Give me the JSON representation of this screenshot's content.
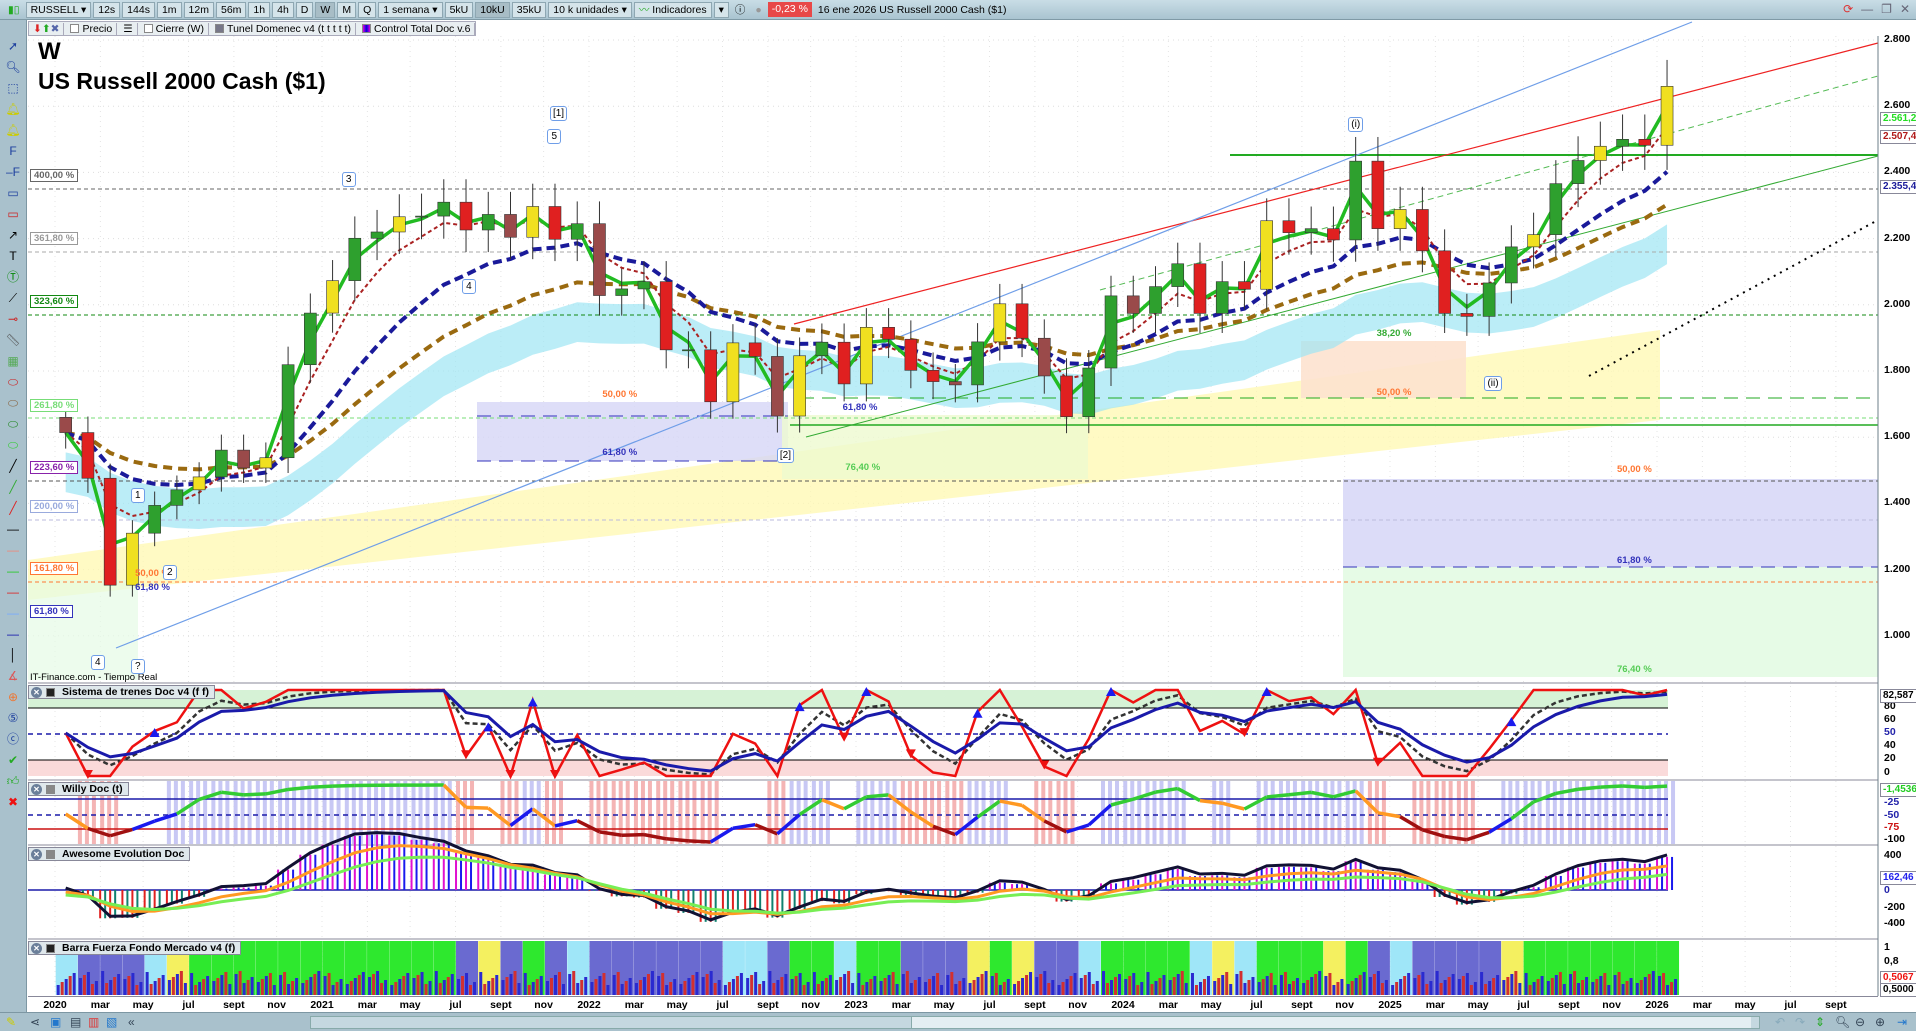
{
  "toolbar": {
    "symbol": "RUSSELL",
    "timeframes": [
      "12s",
      "144s",
      "1m",
      "12m",
      "56m",
      "1h",
      "4h",
      "D",
      "W",
      "M",
      "Q"
    ],
    "selected_timeframe": "W",
    "period": "1 semana",
    "units": [
      "5kU",
      "10kU",
      "35kU"
    ],
    "selected_unit": "10kU",
    "units_select": "10 k unidades",
    "indicators_label": "Indicadores",
    "change": "-0,23 %",
    "date_instrument": "16 ene 2026 US Russell 2000 Cash ($1)"
  },
  "legend": {
    "precio": "Precio",
    "cierre": "Cierre (W)",
    "tunel": "Tunel Domenec v4 (t t t t t)",
    "control": "Control Total Doc v.6"
  },
  "main": {
    "timeframe_letter": "W",
    "instrument_title": "US Russell 2000 Cash ($1)",
    "source": "IT-Finance.com - Tiempo Real",
    "price_ticks": [
      "2.800",
      "2.600",
      "2.400",
      "2.200",
      "2.000",
      "1.800",
      "1.600",
      "1.400",
      "1.200",
      "1.000"
    ],
    "badges": [
      {
        "text": "2.561,2",
        "color": "#22dd22"
      },
      {
        "text": "2.507,4",
        "color": "#b01818"
      },
      {
        "text": "2.355,4",
        "color": "#1a1a9a"
      }
    ],
    "fib_left": [
      {
        "text": "400,00 %",
        "price": 2374,
        "color": "#666666"
      },
      {
        "text": "361,80 %",
        "price": 2184,
        "color": "#999999"
      },
      {
        "text": "323,60 %",
        "price": 1993,
        "color": "#118811"
      },
      {
        "text": "261,80 %",
        "price": 1679,
        "color": "#77dd77"
      },
      {
        "text": "223,60 %",
        "price": 1492,
        "color": "#8822aa"
      },
      {
        "text": "200,00 %",
        "price": 1374,
        "color": "#99aadd"
      },
      {
        "text": "161,80 %",
        "price": 1187,
        "color": "#ff7733"
      },
      {
        "text": "61,80 %",
        "price": 1057,
        "color": "#3333bb"
      }
    ],
    "fib_annotations": [
      {
        "text": "50,00 %",
        "t": 2022.05,
        "price": 1727,
        "color": "#ff7733"
      },
      {
        "text": "61,80 %",
        "t": 2022.95,
        "price": 1688,
        "color": "#3333bb"
      },
      {
        "text": "61,80 %",
        "t": 2022.05,
        "price": 1552,
        "color": "#3333bb"
      },
      {
        "text": "76,40 %",
        "t": 2022.96,
        "price": 1506,
        "color": "#55cc55"
      },
      {
        "text": "38,20 %",
        "t": 2024.95,
        "price": 1912,
        "color": "#33aa33"
      },
      {
        "text": "50,00 %",
        "t": 2024.95,
        "price": 1733,
        "color": "#ff7733"
      },
      {
        "text": "50,00 %",
        "t": 2025.85,
        "price": 1501,
        "color": "#ff7733"
      },
      {
        "text": "61,80 %",
        "t": 2025.85,
        "price": 1226,
        "color": "#3333bb"
      },
      {
        "text": "76,40 %",
        "t": 2025.85,
        "price": 897,
        "color": "#55cc55"
      },
      {
        "text": "50,00 %",
        "t": 2020.3,
        "price": 1188,
        "color": "#ff7733"
      },
      {
        "text": "61,80 %",
        "t": 2020.3,
        "price": 1143,
        "color": "#3333bb"
      }
    ],
    "wave_labels": [
      {
        "text": "3",
        "t": 2021.1,
        "price": 2377
      },
      {
        "text": "4",
        "t": 2021.55,
        "price": 2054
      },
      {
        "text": "1",
        "t": 2020.31,
        "price": 1422
      },
      {
        "text": "2",
        "t": 2020.43,
        "price": 1190
      },
      {
        "text": "4",
        "t": 2020.16,
        "price": 918
      },
      {
        "text": "?",
        "t": 2020.31,
        "price": 906
      },
      {
        "text": "[1]",
        "t": 2021.88,
        "price": 2577
      },
      {
        "text": "5",
        "t": 2021.87,
        "price": 2507
      },
      {
        "text": "[2]",
        "t": 2022.73,
        "price": 1543
      },
      {
        "text": "(i)",
        "t": 2024.87,
        "price": 2543
      },
      {
        "text": "(ii)",
        "t": 2025.38,
        "price": 1761
      }
    ]
  },
  "chart_data": {
    "type": "candlestick",
    "title": "US Russell 2000 Cash ($1)",
    "ylim": [
      860,
      2850
    ],
    "start": 2020.0,
    "step_years": 0.0833,
    "closes": [
      1614,
      1476,
      1153,
      1310,
      1394,
      1441,
      1480,
      1561,
      1507,
      1538,
      1819,
      1975,
      2073,
      2201,
      2220,
      2266,
      2268,
      2310,
      2226,
      2273,
      2204,
      2297,
      2198,
      2245,
      2028,
      2048,
      2070,
      1864,
      1864,
      1707,
      1885,
      1844,
      1664,
      1846,
      1887,
      1761,
      1932,
      1896,
      1802,
      1768,
      1758,
      1888,
      2003,
      1899,
      1785,
      1662,
      1809,
      2027,
      1974,
      2055,
      2124,
      1974,
      2070,
      2047,
      2254,
      2218,
      2230,
      2196,
      2434,
      2230,
      2288,
      2163,
      1974,
      1965,
      2066,
      2175,
      2212,
      2366,
      2436,
      2479,
      2500,
      2482,
      2660
    ]
  },
  "panels": [
    {
      "title": "Sistema de trenes Doc v4 (f f)",
      "ticks": [
        "80",
        "60",
        "50",
        "40",
        "20",
        "0"
      ],
      "badge": "82,587"
    },
    {
      "title": "Willy Doc (t)",
      "ticks": [
        "-25",
        "-50",
        "-75",
        "-100"
      ],
      "badge": "-1,4536"
    },
    {
      "title": "Awesome Evolution Doc",
      "ticks": [
        "400",
        "-200",
        "-400",
        "0"
      ],
      "badge": "162,46"
    },
    {
      "title": "Barra Fuerza Fondo Mercado v4 (f)",
      "ticks": [
        "1",
        "0,8",
        "0,5000"
      ],
      "badge": "0,5067"
    }
  ],
  "time_labels": [
    {
      "t": 2020.0,
      "text": "2020"
    },
    {
      "t": 2020.17,
      "text": "mar"
    },
    {
      "t": 2020.33,
      "text": "may"
    },
    {
      "t": 2020.5,
      "text": "jul"
    },
    {
      "t": 2020.67,
      "text": "sept"
    },
    {
      "t": 2020.83,
      "text": "nov"
    },
    {
      "t": 2021.0,
      "text": "2021"
    },
    {
      "t": 2021.17,
      "text": "mar"
    },
    {
      "t": 2021.33,
      "text": "may"
    },
    {
      "t": 2021.5,
      "text": "jul"
    },
    {
      "t": 2021.67,
      "text": "sept"
    },
    {
      "t": 2021.83,
      "text": "nov"
    },
    {
      "t": 2022.0,
      "text": "2022"
    },
    {
      "t": 2022.17,
      "text": "mar"
    },
    {
      "t": 2022.33,
      "text": "may"
    },
    {
      "t": 2022.5,
      "text": "jul"
    },
    {
      "t": 2022.67,
      "text": "sept"
    },
    {
      "t": 2022.83,
      "text": "nov"
    },
    {
      "t": 2023.0,
      "text": "2023"
    },
    {
      "t": 2023.17,
      "text": "mar"
    },
    {
      "t": 2023.33,
      "text": "may"
    },
    {
      "t": 2023.5,
      "text": "jul"
    },
    {
      "t": 2023.67,
      "text": "sept"
    },
    {
      "t": 2023.83,
      "text": "nov"
    },
    {
      "t": 2024.0,
      "text": "2024"
    },
    {
      "t": 2024.17,
      "text": "mar"
    },
    {
      "t": 2024.33,
      "text": "may"
    },
    {
      "t": 2024.5,
      "text": "jul"
    },
    {
      "t": 2024.67,
      "text": "sept"
    },
    {
      "t": 2024.83,
      "text": "nov"
    },
    {
      "t": 2025.0,
      "text": "2025"
    },
    {
      "t": 2025.17,
      "text": "mar"
    },
    {
      "t": 2025.33,
      "text": "may"
    },
    {
      "t": 2025.5,
      "text": "jul"
    },
    {
      "t": 2025.67,
      "text": "sept"
    },
    {
      "t": 2025.83,
      "text": "nov"
    },
    {
      "t": 2026.0,
      "text": "2026"
    },
    {
      "t": 2026.17,
      "text": "mar"
    },
    {
      "t": 2026.33,
      "text": "may"
    },
    {
      "t": 2026.5,
      "text": "jul"
    },
    {
      "t": 2026.67,
      "text": "sept"
    }
  ],
  "colors": {
    "up": "#2ea02e",
    "down": "#e02020",
    "fast_ma": "#22bb22",
    "slow_ma": "#aa2222",
    "trend_ma": "#1a1a9a",
    "brown_ma": "#9a6a10",
    "cloud": "#9ee6f4"
  }
}
